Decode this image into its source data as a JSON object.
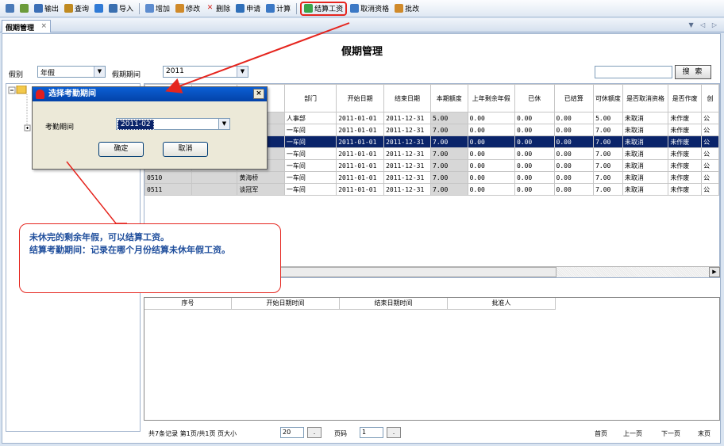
{
  "toolbar": {
    "items": [
      {
        "label": "",
        "icon": "print-icon"
      },
      {
        "label": "",
        "icon": "preview-icon"
      },
      {
        "label": "输出",
        "icon": "export-icon"
      },
      {
        "label": "查询",
        "icon": "query-icon"
      },
      {
        "label": "",
        "icon": "help-icon"
      },
      {
        "label": "导入",
        "icon": "import-icon"
      },
      {
        "label": "增加",
        "icon": "add-icon"
      },
      {
        "label": "修改",
        "icon": "edit-icon"
      },
      {
        "label": "删除",
        "icon": "delete-icon"
      },
      {
        "label": "申请",
        "icon": "apply-icon"
      },
      {
        "label": "计算",
        "icon": "calc-icon"
      },
      {
        "label": "结算工资",
        "icon": "settle-salary-icon"
      },
      {
        "label": "取消资格",
        "icon": "cancel-qualification-icon"
      },
      {
        "label": "批改",
        "icon": "batch-edit-icon"
      }
    ]
  },
  "tab": {
    "label": "假期管理",
    "close": "×",
    "nav": "▼ ◁ ▷"
  },
  "page": {
    "title": "假期管理"
  },
  "filters": {
    "type_label": "假别",
    "type_value": "年假",
    "period_label": "假期期间",
    "period_value": "2011",
    "search_label": "搜 索",
    "search_value": ""
  },
  "grid": {
    "columns": [
      "",
      "",
      "",
      "部门",
      "开始日期",
      "结束日期",
      "本期额度",
      "上年剩余年假",
      "已休",
      "已结算",
      "可休额度",
      "是否取消资格",
      "是否作废",
      "创"
    ],
    "rows": [
      {
        "id": "",
        "c2": "",
        "name": "",
        "dept": "人事部",
        "start": "2011-01-01",
        "end": "2011-12-31",
        "quota": "5.00",
        "prev": "0.00",
        "taken": "0.00",
        "settled": "0.00",
        "avail": "5.00",
        "cancel": "未取消",
        "void": "未作废",
        "creator": "公"
      },
      {
        "id": "",
        "c2": "",
        "name": "",
        "dept": "一车间",
        "start": "2011-01-01",
        "end": "2011-12-31",
        "quota": "7.00",
        "prev": "0.00",
        "taken": "0.00",
        "settled": "0.00",
        "avail": "7.00",
        "cancel": "未取消",
        "void": "未作废",
        "creator": "公"
      },
      {
        "id": "",
        "c2": "",
        "name": "",
        "dept": "一车间",
        "start": "2011-01-01",
        "end": "2011-12-31",
        "quota": "7.00",
        "prev": "0.00",
        "taken": "0.00",
        "settled": "0.00",
        "avail": "7.00",
        "cancel": "未取消",
        "void": "未作废",
        "creator": "公"
      },
      {
        "id": "",
        "c2": "",
        "name": "",
        "dept": "一车间",
        "start": "2011-01-01",
        "end": "2011-12-31",
        "quota": "7.00",
        "prev": "0.00",
        "taken": "0.00",
        "settled": "0.00",
        "avail": "7.00",
        "cancel": "未取消",
        "void": "未作废",
        "creator": "公"
      },
      {
        "id": "",
        "c2": "",
        "name": "",
        "dept": "一车间",
        "start": "2011-01-01",
        "end": "2011-12-31",
        "quota": "7.00",
        "prev": "0.00",
        "taken": "0.00",
        "settled": "0.00",
        "avail": "7.00",
        "cancel": "未取消",
        "void": "未作废",
        "creator": "公"
      },
      {
        "id": "0510",
        "c2": "",
        "name": "黄海桥",
        "dept": "一车间",
        "start": "2011-01-01",
        "end": "2011-12-31",
        "quota": "7.00",
        "prev": "0.00",
        "taken": "0.00",
        "settled": "0.00",
        "avail": "7.00",
        "cancel": "未取消",
        "void": "未作废",
        "creator": "公"
      },
      {
        "id": "0511",
        "c2": "",
        "name": "谈冠军",
        "dept": "一车间",
        "start": "2011-01-01",
        "end": "2011-12-31",
        "quota": "7.00",
        "prev": "0.00",
        "taken": "0.00",
        "settled": "0.00",
        "avail": "7.00",
        "cancel": "未取消",
        "void": "未作废",
        "creator": "公"
      }
    ],
    "selected_row": 2
  },
  "sub_grid": {
    "columns": [
      "序号",
      "开始日期时间",
      "结束日期时间",
      "批准人"
    ]
  },
  "pager": {
    "summary": "共7条记录  第1页/共1页  页大小",
    "page_size": "20",
    "page_label": "页码",
    "page_no": "1",
    "go": ".",
    "first": "首页",
    "prev": "上一页",
    "next": "下一页",
    "last": "末页"
  },
  "dialog": {
    "title": "选择考勤期间",
    "close": "×",
    "field_label": "考勤期间",
    "field_value": "2011-02",
    "ok": "确定",
    "cancel": "取消"
  },
  "callout": {
    "text": "未休完的剩余年假，可以结算工资。\n结算考勤期间：记录在哪个月份结算未休年假工资。"
  },
  "colors": {
    "accent_red": "#e5251e",
    "callout_text": "#1f4e9c",
    "selection": "#0a246a"
  }
}
